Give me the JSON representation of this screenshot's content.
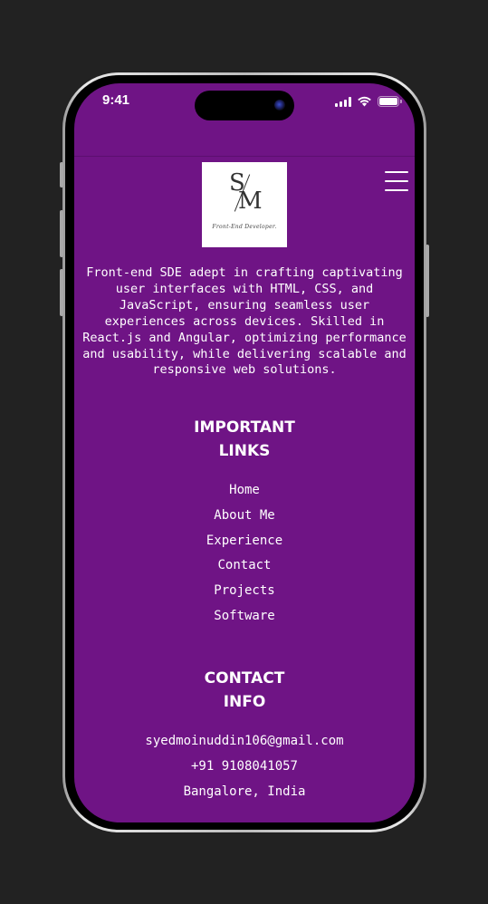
{
  "status_bar": {
    "time": "9:41"
  },
  "logo": {
    "initial_s": "S",
    "initial_m": "M",
    "tagline": "Front-End Developer."
  },
  "intro": {
    "text": "Front-end SDE adept in crafting captivating user interfaces with HTML, CSS, and JavaScript, ensuring seamless user experiences across devices. Skilled in React.js and Angular, optimizing performance and usability, while delivering scalable and responsive web solutions."
  },
  "important_links": {
    "title_line1": "IMPORTANT",
    "title_line2": "LINKS",
    "items": [
      {
        "label": "Home"
      },
      {
        "label": "About Me"
      },
      {
        "label": "Experience"
      },
      {
        "label": "Contact"
      },
      {
        "label": "Projects"
      },
      {
        "label": "Software"
      }
    ]
  },
  "contact_info": {
    "title_line1": "CONTACT",
    "title_line2": "INFO",
    "email": "syedmoinuddin106@gmail.com",
    "phone": "+91 9108041057",
    "location": "Bangalore, India"
  },
  "colors": {
    "background": "#222222",
    "screen": "#6f1485",
    "text": "#ffffff"
  },
  "icons": [
    "signal-icon",
    "wifi-icon",
    "battery-icon",
    "hamburger-menu-icon",
    "camera-icon"
  ]
}
